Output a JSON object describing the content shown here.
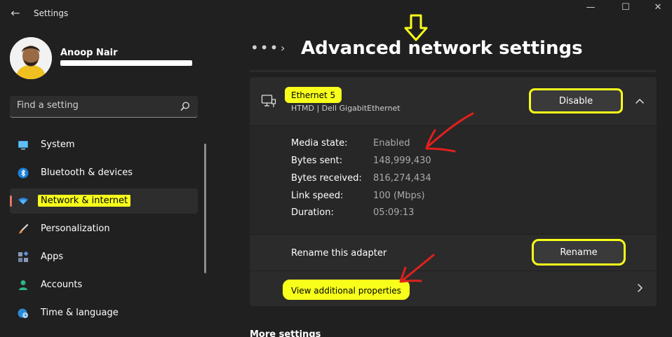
{
  "window": {
    "app_title": "Settings",
    "back_glyph": "←",
    "min_glyph": "—",
    "max_glyph": "☐",
    "close_glyph": "✕"
  },
  "user": {
    "name": "Anoop Nair"
  },
  "search": {
    "placeholder": "Find a setting"
  },
  "sidebar": {
    "items": [
      {
        "label": "System",
        "icon": "monitor-icon"
      },
      {
        "label": "Bluetooth & devices",
        "icon": "bluetooth-icon"
      },
      {
        "label": "Network & internet",
        "icon": "wifi-icon",
        "active": true
      },
      {
        "label": "Personalization",
        "icon": "brush-icon"
      },
      {
        "label": "Apps",
        "icon": "apps-icon"
      },
      {
        "label": "Accounts",
        "icon": "person-icon"
      },
      {
        "label": "Time & language",
        "icon": "globe-clock-icon"
      }
    ]
  },
  "header": {
    "breadcrumb_dots": "•••",
    "breadcrumb_chevron": "›",
    "title": "Advanced network settings"
  },
  "adapter": {
    "name": "Ethernet 5",
    "description": "HTMD | Dell GigabitEthernet",
    "disable_label": "Disable",
    "details": [
      {
        "label": "Media state:",
        "value": "Enabled"
      },
      {
        "label": "Bytes sent:",
        "value": "148,999,430"
      },
      {
        "label": "Bytes received:",
        "value": "816,274,434"
      },
      {
        "label": "Link speed:",
        "value": "100 (Mbps)"
      },
      {
        "label": "Duration:",
        "value": "05:09:13"
      }
    ],
    "rename_label": "Rename this adapter",
    "rename_button": "Rename",
    "view_properties": "View additional properties"
  },
  "more_settings": "More settings",
  "colors": {
    "highlight": "#f7ff1a",
    "annotation_red": "#e0201c",
    "accent_indicator": "#e07a62"
  }
}
